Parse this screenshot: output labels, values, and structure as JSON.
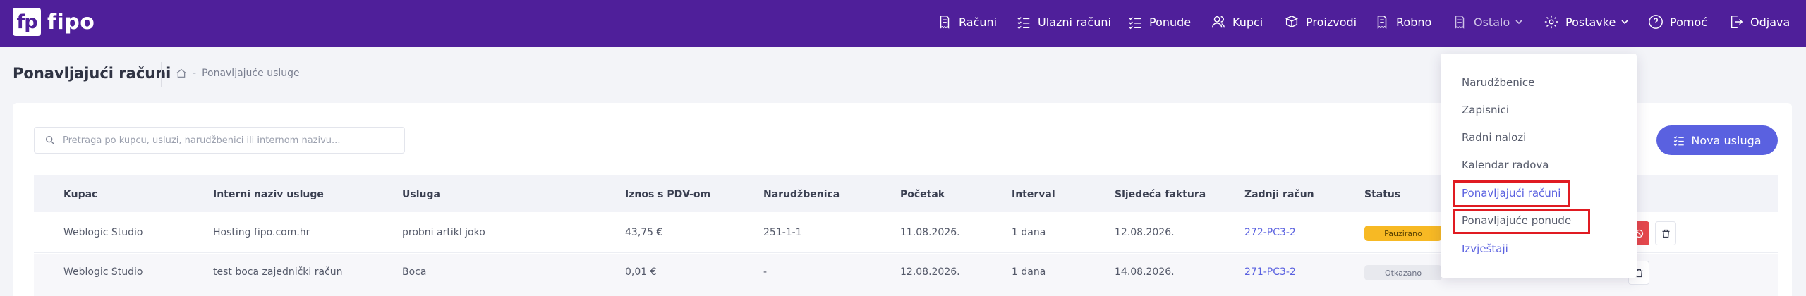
{
  "brand": {
    "logo_mark": "fp",
    "name": "fipo"
  },
  "nav": [
    {
      "label": "Računi",
      "icon": "invoice-icon"
    },
    {
      "label": "Ulazni računi",
      "icon": "checklist-icon"
    },
    {
      "label": "Ponude",
      "icon": "checklist-icon"
    },
    {
      "label": "Kupci",
      "icon": "users-icon"
    },
    {
      "label": "Proizvodi",
      "icon": "products-icon"
    },
    {
      "label": "Robno",
      "icon": "invoice-icon"
    },
    {
      "label": "Ostalo",
      "icon": "invoice-icon"
    },
    {
      "label": "Postavke",
      "icon": "gear-icon"
    },
    {
      "label": "Pomoć",
      "icon": "help-icon"
    },
    {
      "label": "Odjava",
      "icon": "logout-icon"
    }
  ],
  "page": {
    "title": "Ponavljajući računi",
    "breadcrumb": "Ponavljajuće usluge"
  },
  "search": {
    "placeholder": "Pretraga po kupcu, usluzi, narudžbenici ili internom nazivu...",
    "value": ""
  },
  "new_button": {
    "label": "Nova usluga"
  },
  "table": {
    "headers": [
      "Kupac",
      "Interni naziv usluge",
      "Usluga",
      "Iznos s PDV-om",
      "Narudžbenica",
      "Početak",
      "Interval",
      "Sljedeća faktura",
      "Zadnji račun",
      "Status"
    ],
    "rows": [
      {
        "kupac": "Weblogic Studio",
        "interni": "Hosting fipo.com.hr",
        "usluga": "probni artikl joko",
        "iznos": "43,75 €",
        "narudzbenica": "251-1-1",
        "pocetak": "11.08.2026.",
        "interval": "1 dana",
        "sljedeca": "12.08.2026.",
        "zadnji": "272-PC3-2",
        "status": "Pauzirano"
      },
      {
        "kupac": "Weblogic Studio",
        "interni": "test boca zajednički račun",
        "usluga": "Boca",
        "iznos": "0,01 €",
        "narudzbenica": "-",
        "pocetak": "12.08.2026.",
        "interval": "1 dana",
        "sljedeca": "14.08.2026.",
        "zadnji": "271-PC3-2",
        "status": "Otkazano"
      }
    ]
  },
  "dropdown": {
    "items": [
      {
        "label": "Narudžbenice"
      },
      {
        "label": "Zapisnici"
      },
      {
        "label": "Radni nalozi"
      },
      {
        "label": "Kalendar radova"
      },
      {
        "label": "Ponavljajući računi"
      },
      {
        "label": "Ponavljajuće ponude"
      },
      {
        "label": "Izvještaji"
      }
    ]
  },
  "colors": {
    "topbar": "#4f1f9a",
    "accent": "#5a61e0",
    "paused": "#f7b924",
    "highlight": "#e01b22",
    "delete": "#e5484d"
  }
}
